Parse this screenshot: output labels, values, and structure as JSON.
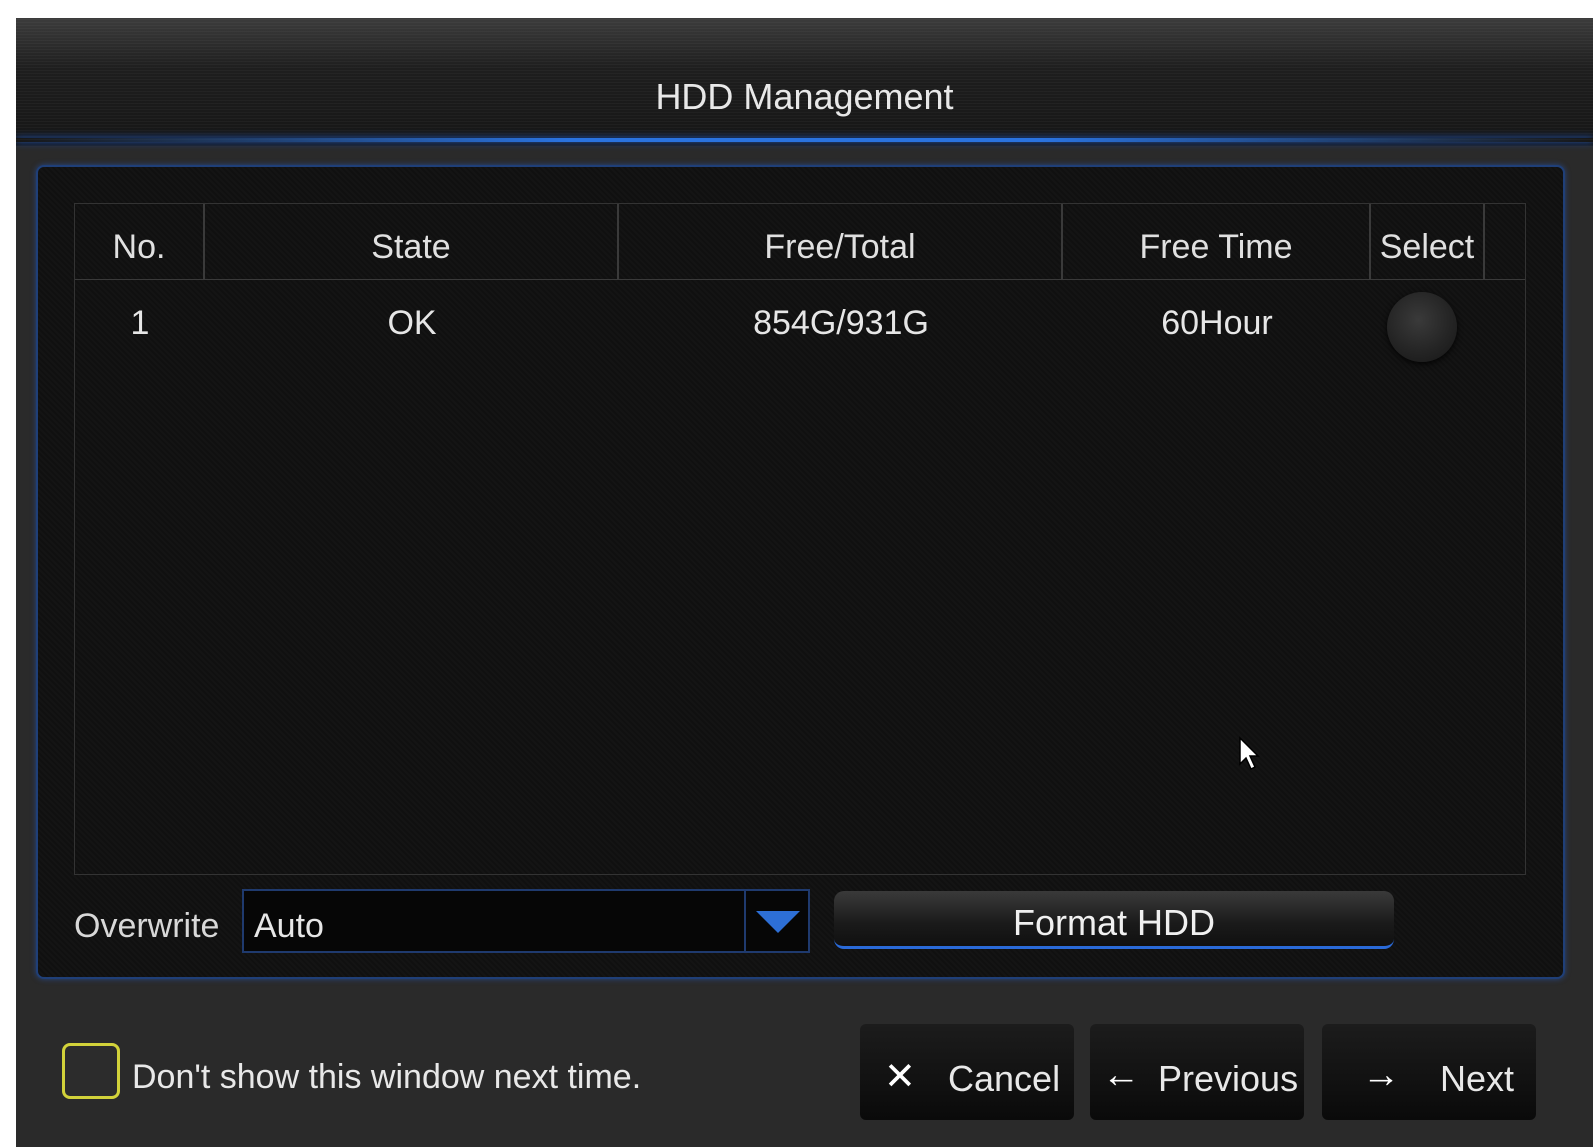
{
  "window": {
    "title": "HDD Management"
  },
  "table": {
    "columns": [
      "No.",
      "State",
      "Free/Total",
      "Free Time",
      "Select"
    ],
    "rows": [
      {
        "no": "1",
        "state": "OK",
        "free_total": "854G/931G",
        "free_time": "60Hour",
        "selected": false
      }
    ]
  },
  "overwrite": {
    "label": "Overwrite",
    "value": "Auto"
  },
  "format_button": "Format HDD",
  "dont_show": {
    "label": "Don't show this window next time.",
    "checked": false
  },
  "footer": {
    "cancel": "Cancel",
    "previous": "Previous",
    "next": "Next"
  },
  "icons": {
    "cancel": "close-icon",
    "previous": "arrow-left-icon",
    "next": "arrow-right-icon",
    "dropdown": "chevron-down-icon"
  },
  "colors": {
    "accent": "#2a73e0",
    "checkbox_border": "#d2d23a",
    "background": "#2a2a2a"
  }
}
